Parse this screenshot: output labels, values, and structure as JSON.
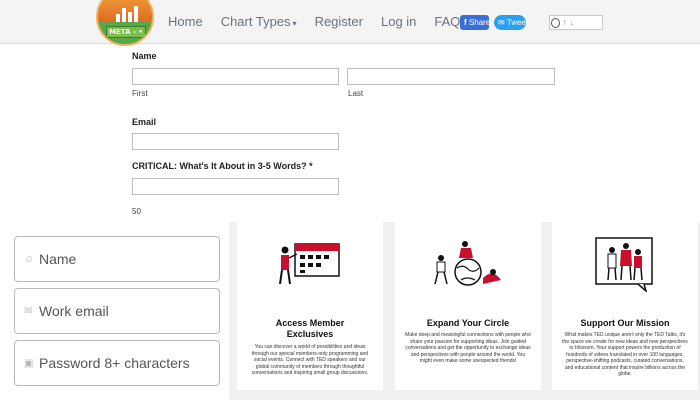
{
  "nav": {
    "logo_text": "META - •",
    "links": [
      {
        "label": "Home"
      },
      {
        "label": "Chart Types"
      },
      {
        "label": "Register"
      },
      {
        "label": "Log in"
      },
      {
        "label": "FAQ"
      }
    ],
    "dropdown_caret": "▾",
    "share_facebook": "Share",
    "share_twitter": "Tweet",
    "reddit_score": "↑ ↓"
  },
  "form": {
    "name_label": "Name",
    "first_label": "First",
    "last_label": "Last",
    "email_label": "Email",
    "critical_label": "CRITICAL: What's It About in 3-5 Words? *",
    "char_count": "50"
  },
  "signup": {
    "fields": [
      {
        "icon": "person-icon",
        "glyph": "☺",
        "placeholder": "Name"
      },
      {
        "icon": "mail-icon",
        "glyph": "✉",
        "placeholder": "Work email"
      },
      {
        "icon": "lock-icon",
        "glyph": "▣",
        "placeholder": "Password 8+ characters"
      }
    ]
  },
  "cards": [
    {
      "title_line1": "Access Member",
      "title_line2": "Exclusives",
      "body": "You can discover a world of possibilities and ideas through our special members-only programming and social events. Connect with TED speakers and our global community of members through thoughtful conversations and inspiring small group discussions."
    },
    {
      "title_line1": "Expand Your Circle",
      "body": "Make deep and meaningful connections with people who share your passion for supporting ideas. Join guided conversations and get the opportunity to exchange ideas and perspectives with people around the world. You might even make some unexpected friends!"
    },
    {
      "title_line1": "Support Our Mission",
      "body": "What makes TED unique aren't only the TED Talks, it's the space we create for new ideas and new perspectives to blossom. Your support powers the production of hundreds of videos translated in over 100 languages, perspective-shifting podcasts, curated conversations, and educational content that inspire billions across the globe."
    }
  ],
  "colors": {
    "accent_red": "#c8102e",
    "facebook_blue": "#3b6fd8",
    "twitter_blue": "#2a9ff2",
    "nav_text": "#6a7280"
  }
}
